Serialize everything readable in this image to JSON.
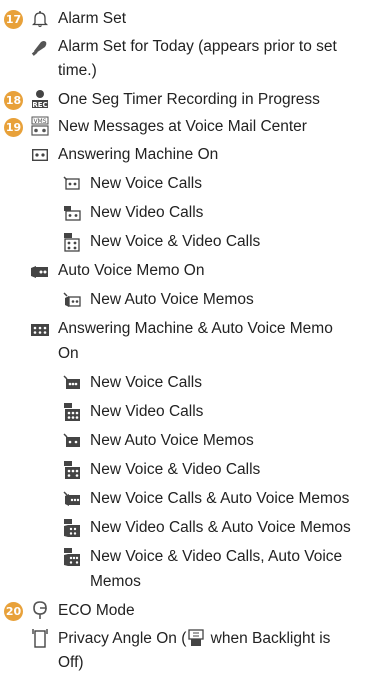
{
  "sections": [
    {
      "number": "17",
      "icon": "alarm-bell-icon",
      "label": "Alarm Set",
      "items": [
        {
          "icon": "alarm-today-icon",
          "label_line1": "Alarm Set for Today (appears prior to set",
          "label_line2": "time.)"
        }
      ]
    },
    {
      "number": "18",
      "icon": "rec-timer-icon",
      "label": "One Seg Timer Recording in Progress"
    },
    {
      "number": "19",
      "icon": "voicemail-center-icon",
      "label": "New Messages at Voice Mail Center",
      "groups": [
        {
          "icon": "answering-machine-icon",
          "label": "Answering Machine On",
          "items": [
            {
              "icon": "new-voice-calls-icon",
              "label": "New Voice Calls"
            },
            {
              "icon": "new-video-calls-icon",
              "label": "New Video Calls"
            },
            {
              "icon": "new-voice-video-calls-icon",
              "label": "New Voice & Video Calls"
            }
          ]
        },
        {
          "icon": "auto-voice-memo-icon",
          "label": "Auto Voice Memo On",
          "items": [
            {
              "icon": "new-auto-voice-memos-icon",
              "label": "New Auto Voice Memos"
            }
          ]
        },
        {
          "icon": "answering-and-memo-icon",
          "label_line1": "Answering Machine & Auto Voice Memo",
          "label_line2": "On",
          "items": [
            {
              "icon": "new-voice-calls-icon",
              "label": "New Voice Calls"
            },
            {
              "icon": "new-video-calls-icon",
              "label": "New Video Calls"
            },
            {
              "icon": "new-auto-voice-memos-icon",
              "label": "New Auto Voice Memos"
            },
            {
              "icon": "new-voice-video-calls-icon",
              "label": "New Voice & Video Calls"
            },
            {
              "icon": "new-voice-calls-memos-icon",
              "label": "New Voice Calls & Auto Voice Memos"
            },
            {
              "icon": "new-video-calls-memos-icon",
              "label": "New Video Calls & Auto Voice Memos"
            },
            {
              "icon": "new-voice-video-memos-icon",
              "label_line1": "New Voice & Video Calls, Auto Voice",
              "label_line2": "Memos"
            }
          ]
        }
      ]
    },
    {
      "number": "20",
      "icon": "eco-mode-icon",
      "label": "ECO Mode",
      "items": [
        {
          "icon": "privacy-angle-icon",
          "label_part1": "Privacy Angle On (",
          "inline_icon": "privacy-angle-backlight-off-icon",
          "label_part2": " when Backlight is",
          "label_line2": "Off)"
        }
      ]
    }
  ]
}
